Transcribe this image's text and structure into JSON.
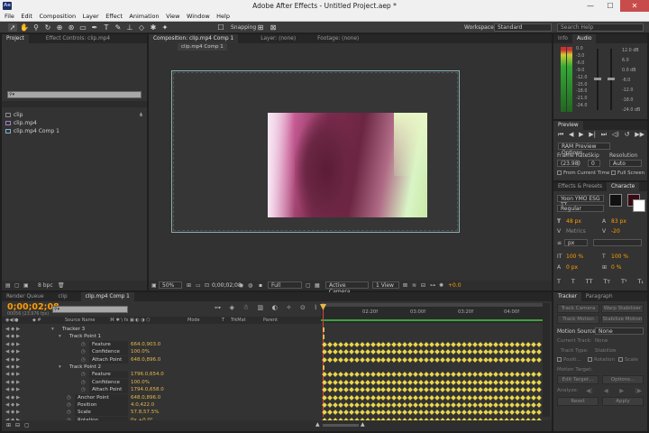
{
  "window": {
    "title": "Adobe After Effects - Untitled Project.aep *",
    "logo": "Ae",
    "minimize": "—",
    "maximize": "☐",
    "close": "✕"
  },
  "menu": [
    "File",
    "Edit",
    "Composition",
    "Layer",
    "Effect",
    "Animation",
    "View",
    "Window",
    "Help"
  ],
  "toolbar": {
    "snapping": "Snapping",
    "workspace_label": "Workspace:",
    "workspace_value": "Standard",
    "search_placeholder": "Search Help"
  },
  "project_panel": {
    "tab_project": "Project",
    "tab_effect_controls": "Effect Controls: clip.mp4",
    "items": [
      "clip",
      "clip.mp4",
      "clip.mp4 Comp 1"
    ],
    "bpc": "8 bpc"
  },
  "comp_panel": {
    "tab_composition": "Composition: clip.mp4 Comp 1",
    "tab_layer": "Layer: (none)",
    "tab_footage": "Footage: (none)",
    "breadcrumb": "clip.mp4 Comp 1",
    "zoom": "50%",
    "timecode": "0;00;02;08",
    "resolution": "Full",
    "camera": "Active Camera",
    "view": "1 View",
    "exposure": "+0.0"
  },
  "info_panel": {
    "tab_info": "Info",
    "tab_audio": "Audio",
    "db_left": [
      "0.0",
      "-3.0",
      "-6.0",
      "-9.0",
      "-12.0",
      "-15.0",
      "-18.0",
      "-21.0",
      "-24.0"
    ],
    "db_right": [
      "12.0 dB",
      "6.0",
      "0.0 dB",
      "-6.0",
      "-12.0",
      "-18.0",
      "-24.0 dB"
    ]
  },
  "preview_panel": {
    "tab": "Preview",
    "ram_options": "RAM Preview Options",
    "frame_rate_label": "Frame Rate",
    "skip_label": "Skip",
    "resolution_label": "Resolution",
    "frame_rate_value": "(23.98)",
    "skip_value": "0",
    "resolution_value": "Auto",
    "from_current": "From Current Time",
    "full_screen": "Full Screen"
  },
  "character_panel": {
    "tab_effects": "Effects & Presets",
    "tab_character": "Characte",
    "font": "Yoon YMO ESG  TT",
    "style": "Regular",
    "size": "48 px",
    "leading": "83 px",
    "tracking": "-20",
    "metrics": "Metrics",
    "stroke_unit": "px",
    "vscale": "100 %",
    "hscale": "100 %",
    "baseline": "0 px",
    "tsume": "0 %"
  },
  "timeline": {
    "tab_render": "Render Queue",
    "tab_clip": "clip",
    "tab_comp": "clip.mp4 Comp 1",
    "timecode": "0;00;02;08",
    "fps": "00056 (23.976 fps)",
    "col_source": "Source Name",
    "col_mode": "Mode",
    "col_trkmat": "TrkMat",
    "col_parent": "Parent",
    "ruler": [
      "02:20f",
      "03:00f",
      "03:20f",
      "04:00f"
    ],
    "rows": [
      {
        "label": "Tracker 3",
        "value": "",
        "indent": 64
      },
      {
        "label": "Track Point 1",
        "value": "",
        "indent": 72
      },
      {
        "label": "Feature Center",
        "value": "664.0,903.0",
        "indent": 97
      },
      {
        "label": "Confidence",
        "value": "100.0%",
        "indent": 97
      },
      {
        "label": "Attach Point",
        "value": "648.0,896.0",
        "indent": 97
      },
      {
        "label": "Track Point 2",
        "value": "",
        "indent": 72
      },
      {
        "label": "Feature Center",
        "value": "1796.0,654.0",
        "indent": 97
      },
      {
        "label": "Confidence",
        "value": "100.0%",
        "indent": 97
      },
      {
        "label": "Attach Point",
        "value": "1794.0,658.0",
        "indent": 97
      },
      {
        "label": "Anchor Point",
        "value": "648.0,896.0",
        "indent": 81
      },
      {
        "label": "Position",
        "value": "4.0,422.0",
        "indent": 81
      },
      {
        "label": "Scale",
        "value": "57.8,57.5%",
        "indent": 81
      },
      {
        "label": "Rotation",
        "value": "0x +0.0°",
        "indent": 81
      }
    ]
  },
  "tracker_panel": {
    "tab_tracker": "Tracker",
    "tab_paragraph": "Paragraph",
    "track_camera": "Track Camera",
    "warp_stabilizer": "Warp Stabilizer",
    "track_motion": "Track Motion",
    "stabilize_motion": "Stabilize Motion",
    "motion_source_label": "Motion Source:",
    "motion_source_value": "None",
    "current_track_label": "Current Track:",
    "current_track_value": "None",
    "track_type_label": "Track Type:",
    "track_type_value": "Stabilize",
    "position_label": "Positi...",
    "rotation_label": "Rotation",
    "scale_label": "Scale",
    "motion_target_label": "Motion Target:",
    "edit_target": "Edit Target...",
    "options": "Options...",
    "analyze_label": "Analyze:",
    "reset": "Reset",
    "apply": "Apply"
  },
  "colors": {
    "accent_orange": "#ff9c00",
    "value_yellow": "#e6b84a",
    "keyframe": "#e8d64a",
    "comp_border": "#8ab0b0"
  }
}
